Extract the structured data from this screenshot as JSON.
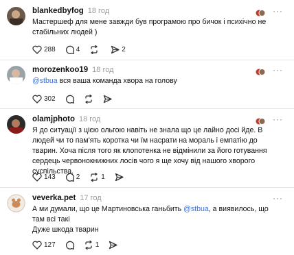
{
  "posts": [
    {
      "username": "blankedbyfog",
      "time": "18 год",
      "text": [
        "Мастершеф для мене завжди був програмою про бичок і психічно не стабільних людей )"
      ],
      "likes": "288",
      "comments": "4",
      "reposts": "",
      "shares": "2"
    },
    {
      "username": "morozenkoo19",
      "time": "18 год",
      "mention": "@stbua",
      "text_after": " вся ваша команда хвора на голову",
      "likes": "302",
      "comments": "",
      "reposts": "",
      "shares": ""
    },
    {
      "username": "olamjphoto",
      "time": "18 год",
      "text": [
        "Я до ситуації з цією ольгою навіть не знала що це лайно досі йде. В людей чи то пам'ять коротка чи їм насрати на мораль і емпатію до тварин. Хоча після того як клопотенка не відмінили за його готування сердець червонокнижних лосів чого я ще хочу від нашого хворого суспільства."
      ],
      "likes": "143",
      "comments": "2",
      "reposts": "1",
      "shares": ""
    },
    {
      "username": "veverka.pet",
      "time": "17 год",
      "text_before": "А ми думали, що це Мартиновська ганьбить ",
      "mention": "@stbua",
      "text_after": ", а виявилось, що там всі такі",
      "line2": "Дуже шкода тварин",
      "likes": "127",
      "comments": "",
      "reposts": "1",
      "shares": ""
    }
  ],
  "icons": {
    "like": "heart-icon",
    "comment": "comment-icon",
    "repost": "repost-icon",
    "share": "share-icon",
    "more": "more-icon"
  },
  "colors": {
    "mention": "#3b6fd8",
    "muted": "#9a9a9a",
    "divider": "#e4e4e4"
  }
}
